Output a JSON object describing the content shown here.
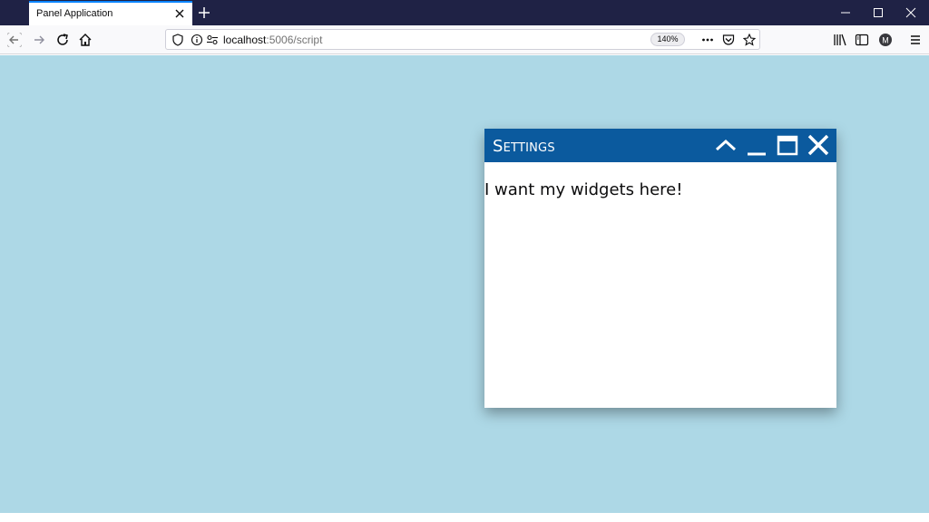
{
  "browser": {
    "tab_title": "Panel Application",
    "url_host": "localhost",
    "url_path": ":5006/script",
    "zoom": "140%",
    "profile_initial": "M"
  },
  "icons": [
    "close-icon",
    "plus-icon",
    "minimize-icon",
    "maximize-icon",
    "back-icon",
    "forward-icon",
    "reload-icon",
    "home-icon",
    "shield-icon",
    "info-icon",
    "permissions-icon",
    "more-icon",
    "pocket-icon",
    "star-icon",
    "library-icon",
    "sidebar-icon",
    "account-icon",
    "menu-icon",
    "chevron-up-icon"
  ],
  "colors": {
    "page_background": "#add8e6",
    "panel_header": "#0b5a9e",
    "tabstrip": "#1f2245"
  },
  "panel": {
    "title": "Settings",
    "body_text": "I want my widgets here!"
  }
}
